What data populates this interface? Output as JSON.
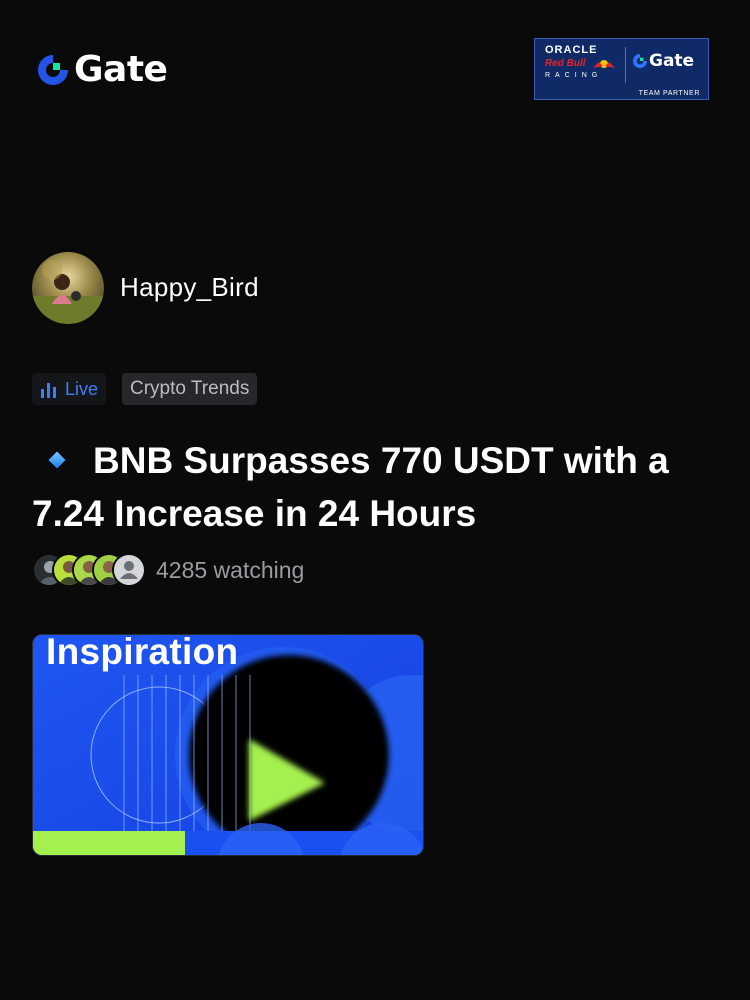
{
  "header": {
    "logo_text": "Gate",
    "partner": {
      "oracle": "ORACLE",
      "redbull": "Red Bull",
      "racing": "RACING",
      "gate": "Gate",
      "team_partner": "TEAM PARTNER"
    }
  },
  "post": {
    "author": "Happy_Bird",
    "tags": {
      "live": "Live",
      "topic": "Crypto Trends"
    },
    "title": "BNB Surpasses 770 USDT with a 7.24 Increase in 24 Hours",
    "watching_count": "4285",
    "watching_label": "4285 watching",
    "thumbnail_caption": "Inspiration"
  },
  "colors": {
    "background": "#0a0a0b",
    "brand_blue": "#2354e6",
    "brand_green": "#17e5a0",
    "accent_lime": "#a4f04f",
    "live_blue": "#3d7ff5"
  },
  "icons": {
    "logo": "gate-logo-icon",
    "live": "bar-chart-icon",
    "title_bullet": "diamond-icon",
    "default_avatar": "user-silhouette-icon"
  }
}
